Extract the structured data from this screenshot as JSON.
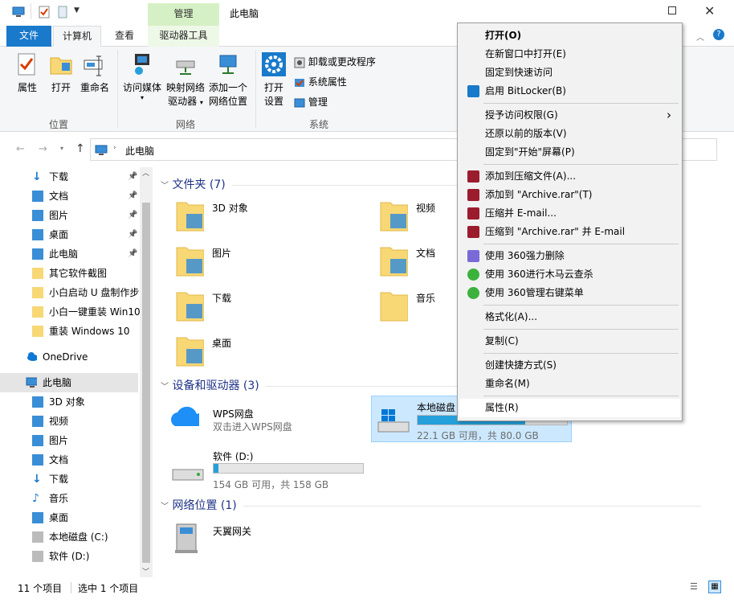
{
  "window": {
    "title": "此电脑",
    "manage_tab": "管理"
  },
  "tabs": [
    "文件",
    "计算机",
    "查看",
    "驱动器工具"
  ],
  "ribbon": {
    "location": {
      "label": "位置",
      "buttons": [
        "属性",
        "打开",
        "重命名"
      ]
    },
    "network": {
      "label": "网络",
      "media_1": "访问媒体",
      "map_1": "映射网络",
      "map_2": "驱动器",
      "add_1": "添加一个",
      "add_2": "网络位置"
    },
    "system": {
      "label": "系统",
      "open_1": "打开",
      "open_2": "设置",
      "uninstall": "卸载或更改程序",
      "sysprop": "系统属性",
      "manage": "管理"
    }
  },
  "address": {
    "path": "此电脑"
  },
  "nav": {
    "quick": [
      {
        "label": "下载",
        "pinned": true
      },
      {
        "label": "文档",
        "pinned": true
      },
      {
        "label": "图片",
        "pinned": true
      },
      {
        "label": "桌面",
        "pinned": true
      },
      {
        "label": "此电脑",
        "pinned": true
      },
      {
        "label": "其它软件截图",
        "pinned": false
      },
      {
        "label": "小白启动 U 盘制作步",
        "pinned": false
      },
      {
        "label": "小白一键重装 Win10",
        "pinned": false
      },
      {
        "label": "重装 Windows 10",
        "pinned": false
      }
    ],
    "onedrive": "OneDrive",
    "thispc": "此电脑",
    "pc_children": [
      "3D 对象",
      "视频",
      "图片",
      "文档",
      "下载",
      "音乐",
      "桌面",
      "本地磁盘 (C:)",
      "软件 (D:)"
    ]
  },
  "content": {
    "folders_header": "文件夹 (7)",
    "folders": [
      "3D 对象",
      "视频",
      "图片",
      "文档",
      "下载",
      "音乐",
      "桌面"
    ],
    "devices_header": "设备和驱动器 (3)",
    "wps": {
      "name": "WPS网盘",
      "sub": "双击进入WPS网盘"
    },
    "drive_c": {
      "name": "本地磁盘",
      "free": "22.1 GB 可用，共 80.0 GB",
      "used_fraction": 0.72
    },
    "drive_d": {
      "name": "软件 (D:)",
      "free": "154 GB 可用，共 158 GB",
      "used_fraction": 0.03
    },
    "network_header": "网络位置 (1)",
    "network_item": "天翼网关"
  },
  "status": {
    "count": "11 个项目",
    "selected": "选中 1 个项目"
  },
  "context_menu": [
    {
      "label": "打开(O)",
      "bold": true
    },
    {
      "label": "在新窗口中打开(E)"
    },
    {
      "label": "固定到快速访问"
    },
    {
      "label": "启用 BitLocker(B)",
      "icon": "shield"
    },
    {
      "sep": true
    },
    {
      "label": "授予访问权限(G)",
      "submenu": true
    },
    {
      "label": "还原以前的版本(V)"
    },
    {
      "label": "固定到\"开始\"屏幕(P)"
    },
    {
      "sep": true
    },
    {
      "label": "添加到压缩文件(A)...",
      "icon": "rar"
    },
    {
      "label": "添加到 \"Archive.rar\"(T)",
      "icon": "rar"
    },
    {
      "label": "压缩并 E-mail...",
      "icon": "rar"
    },
    {
      "label": "压缩到 \"Archive.rar\" 并 E-mail",
      "icon": "rar"
    },
    {
      "sep": true
    },
    {
      "label": "使用 360强力删除",
      "icon": "360del"
    },
    {
      "label": "使用 360进行木马云查杀",
      "icon": "360"
    },
    {
      "label": "使用 360管理右键菜单",
      "icon": "360"
    },
    {
      "sep": true
    },
    {
      "label": "格式化(A)..."
    },
    {
      "sep": true
    },
    {
      "label": "复制(C)"
    },
    {
      "sep": true
    },
    {
      "label": "创建快捷方式(S)"
    },
    {
      "label": "重命名(M)"
    },
    {
      "sep": true
    },
    {
      "label": "属性(R)",
      "hover": true
    }
  ],
  "colors": {
    "accent": "#1979ca",
    "manage_tab": "#d6f0c5",
    "selection": "#cce8ff",
    "folder": "#f8d775",
    "drive_bar": "#26a0da"
  }
}
